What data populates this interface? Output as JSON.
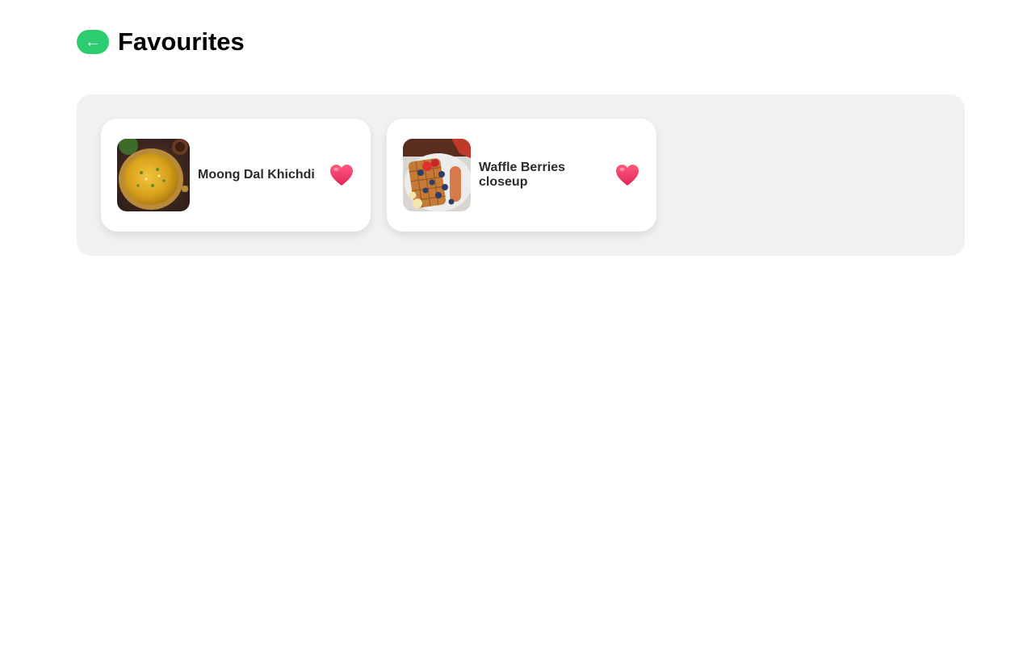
{
  "header": {
    "back_label": "←",
    "title": "Favourites"
  },
  "colors": {
    "accent": "#2ecc71",
    "panel_bg": "#f1f1f1",
    "heart": "#f0386b"
  },
  "favourites": [
    {
      "name": "Moong Dal Khichdi",
      "image_icon": "khichdi-photo",
      "favourite_icon": "heart-icon"
    },
    {
      "name": "Waffle Berries closeup",
      "image_icon": "waffle-photo",
      "favourite_icon": "heart-icon"
    }
  ]
}
